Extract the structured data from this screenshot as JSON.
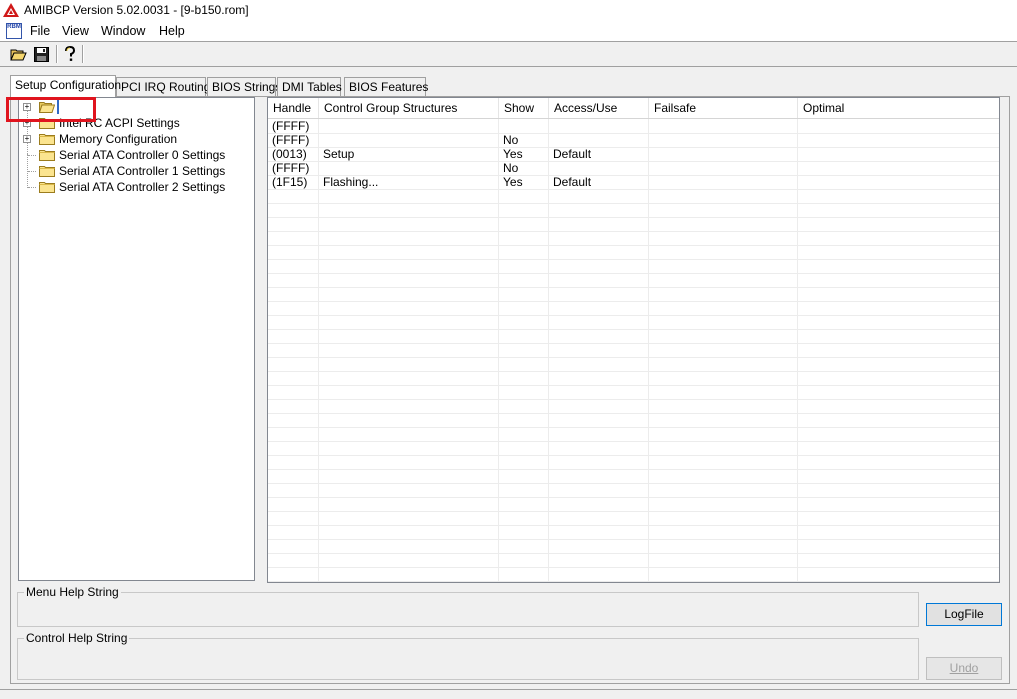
{
  "app": {
    "title": "AMIBCP Version 5.02.0031 - [9-b150.rom]",
    "mdi_icon_text": "RBM"
  },
  "menu": [
    "File",
    "View",
    "Window",
    "Help"
  ],
  "toolbar": {
    "icons": [
      "open-folder-icon",
      "save-disk-icon",
      "help-question-icon"
    ]
  },
  "tabs": [
    {
      "label": "Setup Configuration",
      "active": true
    },
    {
      "label": "PCI IRQ Routing",
      "active": false
    },
    {
      "label": "BIOS Strings",
      "active": false
    },
    {
      "label": "DMI Tables",
      "active": false
    },
    {
      "label": "BIOS Features",
      "active": false
    }
  ],
  "tree": {
    "items": [
      {
        "label": "",
        "expandable": true,
        "selected": true
      },
      {
        "label": "Intel RC ACPI Settings",
        "expandable": true
      },
      {
        "label": "Memory Configuration",
        "expandable": true
      },
      {
        "label": "Serial ATA Controller 0 Settings",
        "expandable": false
      },
      {
        "label": "Serial ATA Controller 1 Settings",
        "expandable": false
      },
      {
        "label": "Serial ATA Controller 2 Settings",
        "expandable": false
      }
    ]
  },
  "grid": {
    "columns": [
      "Handle",
      "Control Group Structures",
      "Show",
      "Access/Use",
      "Failsafe",
      "Optimal"
    ],
    "rows": [
      [
        "(FFFF)",
        "",
        "",
        "",
        "",
        ""
      ],
      [
        "(FFFF)",
        "",
        "No",
        "",
        "",
        ""
      ],
      [
        "(0013)",
        "Setup",
        "Yes",
        "Default",
        "",
        ""
      ],
      [
        "(FFFF)",
        "",
        "No",
        "",
        "",
        ""
      ],
      [
        "(1F15)",
        "Flashing...",
        "Yes",
        "Default",
        "",
        ""
      ]
    ]
  },
  "help": {
    "menu_help_label": "Menu Help String",
    "control_help_label": "Control Help String"
  },
  "buttons": {
    "logfile": "LogFile",
    "undo": "Undo"
  },
  "colors": {
    "highlight": "#e0141e",
    "window_bg": "#f0f0f0"
  }
}
